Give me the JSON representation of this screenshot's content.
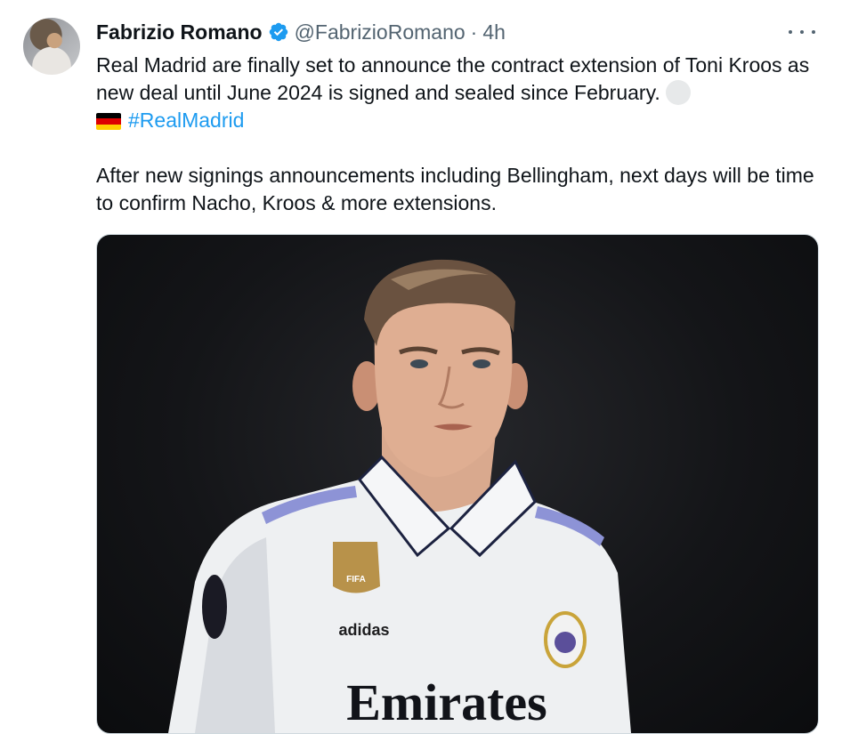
{
  "tweet": {
    "author_name": "Fabrizio Romano",
    "handle": "@FabrizioRomano",
    "separator": "·",
    "time": "4h",
    "paragraph1": "Real Madrid are finally set to announce the contract extension of Toni Kroos as new deal until June 2024 is signed and sealed since February.",
    "hashtag": "#RealMadrid",
    "paragraph2": "After new signings announcements including Bellingham, next days will be time to confirm Nacho, Kroos & more extensions.",
    "media": {
      "jersey_sponsor": "Emirates",
      "kit_brand": "adidas",
      "badge_text": "FIFA"
    }
  },
  "colors": {
    "verified_badge": "#1d9bf0",
    "hashtag": "#1d9bf0",
    "secondary_text": "#536471",
    "flag_black": "#000000",
    "flag_red": "#dd0000",
    "flag_gold": "#ffce00"
  },
  "icons": {
    "verified": "verified-badge-icon",
    "more": "more-options-icon",
    "flag": "germany-flag-icon"
  }
}
